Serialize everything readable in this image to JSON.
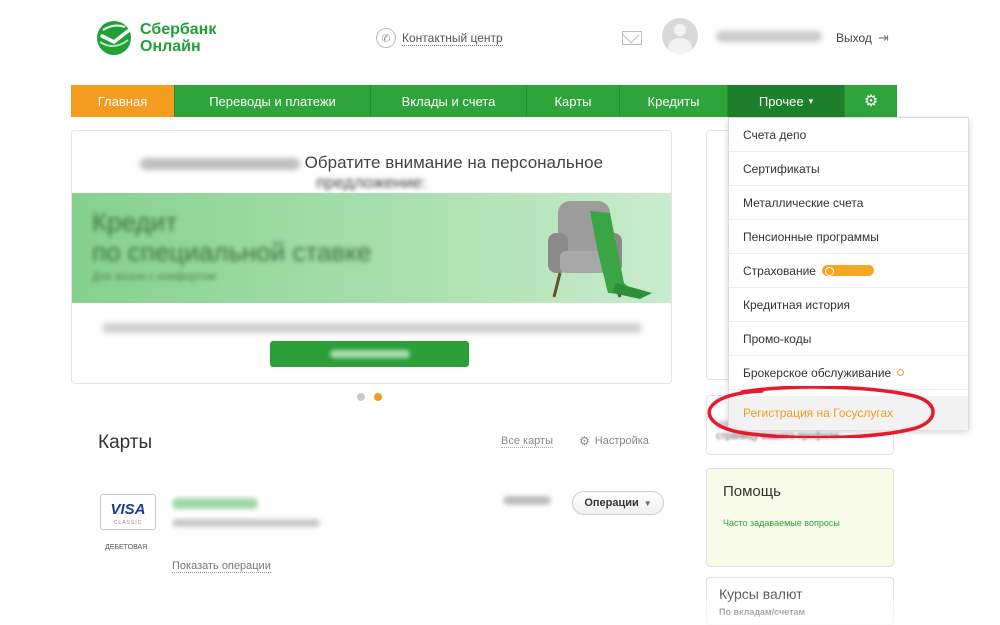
{
  "header": {
    "logo_line1": "Сбербанк",
    "logo_line2": "Онлайн",
    "contact_label": "Контактный центр",
    "logout_label": "Выход"
  },
  "nav": {
    "items": [
      {
        "label": "Главная"
      },
      {
        "label": "Переводы и платежи"
      },
      {
        "label": "Вклады и счета"
      },
      {
        "label": "Карты"
      },
      {
        "label": "Кредиты"
      },
      {
        "label": "Прочее"
      }
    ],
    "more_caret": "▾"
  },
  "promo": {
    "heading_part1": "Обратите внимание на персональное",
    "heading_part2": "предложение:",
    "banner_title_line1": "Кредит",
    "banner_title_line2": "по специальной ставке",
    "banner_subtitle": "Для жизни с комфортом"
  },
  "cards": {
    "title": "Карты",
    "all_cards_link": "Все карты",
    "settings_link": "Настройка",
    "visa_word": "VISA",
    "visa_sub": "CLASSIC",
    "card_type": "ДЕБЕТОВАЯ",
    "operations_button": "Операции",
    "show_operations_link": "Показать операции"
  },
  "sidebar": {
    "help_title": "Помощь",
    "help_link": "Часто задаваемые вопросы",
    "fx_title": "Курсы валют",
    "fx_subtitle": "По вкладам/счетам",
    "peek_text": "страницу вашего профиля"
  },
  "dropdown": {
    "items": [
      {
        "label": "Счета депо"
      },
      {
        "label": "Сертификаты"
      },
      {
        "label": "Металлические счета"
      },
      {
        "label": "Пенсионные программы"
      },
      {
        "label": "Страхование"
      },
      {
        "label": "Кредитная история"
      },
      {
        "label": "Промо-коды"
      },
      {
        "label": "Брокерское обслуживание"
      },
      {
        "label": "Регистрация на Госуслугах"
      }
    ]
  },
  "colors": {
    "brand_green": "#2ea43a",
    "accent_orange": "#f39c1f",
    "annotation_red": "#e8192c"
  }
}
